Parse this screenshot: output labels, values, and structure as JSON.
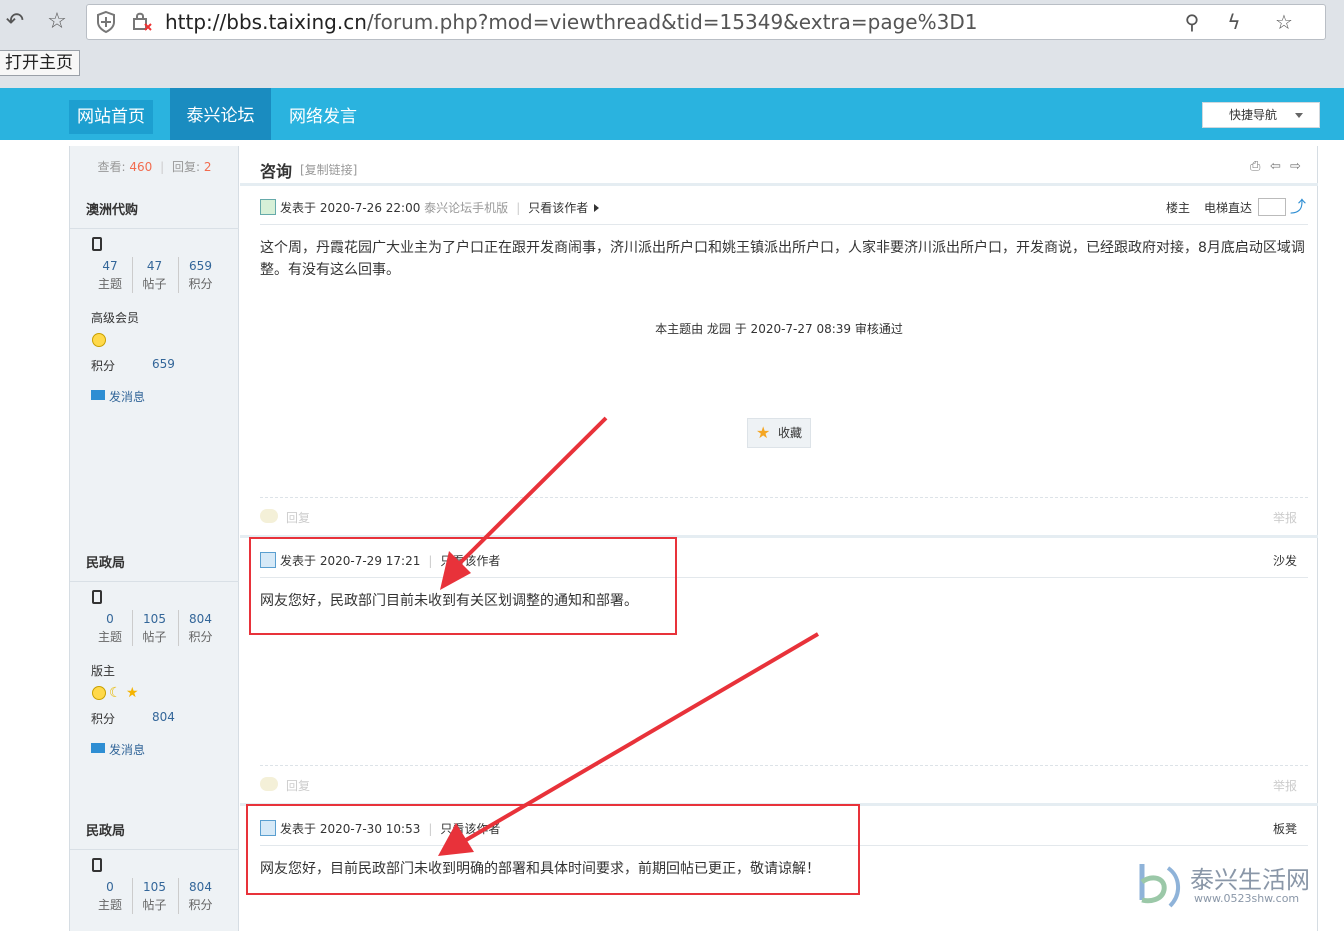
{
  "browser": {
    "url_host": "http://bbs.taixing.cn",
    "url_path": "/forum.php?mod=viewthread&tid=15349&extra=page%3D1",
    "home_button": "打开主页"
  },
  "site_nav": {
    "items": [
      "网站首页",
      "泰兴论坛",
      "网络发言"
    ],
    "quick_nav": "快捷导航"
  },
  "thread": {
    "views_label": "查看:",
    "views": "460",
    "replies_label": "回复:",
    "replies": "2",
    "title": "咨询",
    "copy_link": "[复制链接]",
    "posts": [
      {
        "author": "澳洲代购",
        "stats": [
          {
            "v": "47",
            "k": "主题"
          },
          {
            "v": "47",
            "k": "帖子"
          },
          {
            "v": "659",
            "k": "积分"
          }
        ],
        "rank": "高级会员",
        "points_label": "积分",
        "points": "659",
        "message_link": "发消息",
        "posted_prefix": "发表于",
        "posted_time": "2020-7-26 22:00",
        "source": "泰兴论坛手机版",
        "only_author": "只看该作者",
        "floor": "楼主",
        "elevator": "电梯直达",
        "body": "这个周，丹霞花园广大业主为了户口正在跟开发商闹事，济川派出所户口和姚王镇派出所户口，人家非要济川派出所户口，开发商说，已经跟政府对接，8月底启动区域调整。有没有这么回事。",
        "approved": "本主题由 龙园 于 2020-7-27 08:39 审核通过",
        "favorite": "收藏",
        "reply": "回复",
        "report": "举报"
      },
      {
        "author": "民政局",
        "stats": [
          {
            "v": "0",
            "k": "主题"
          },
          {
            "v": "105",
            "k": "帖子"
          },
          {
            "v": "804",
            "k": "积分"
          }
        ],
        "rank": "版主",
        "points_label": "积分",
        "points": "804",
        "message_link": "发消息",
        "posted_prefix": "发表于",
        "posted_time": "2020-7-29 17:21",
        "only_author": "只看该作者",
        "floor": "沙发",
        "body": "网友您好，民政部门目前未收到有关区划调整的通知和部署。",
        "reply": "回复",
        "report": "举报"
      },
      {
        "author": "民政局",
        "stats": [
          {
            "v": "0",
            "k": "主题"
          },
          {
            "v": "105",
            "k": "帖子"
          },
          {
            "v": "804",
            "k": "积分"
          }
        ],
        "posted_prefix": "发表于",
        "posted_time": "2020-7-30 10:53",
        "only_author": "只看该作者",
        "floor": "板凳",
        "body": "网友您好，目前民政部门未收到明确的部署和具体时间要求，前期回帖已更正，敬请谅解！"
      }
    ]
  },
  "watermark": {
    "name": "泰兴生活网",
    "url": "www.0523shw.com"
  },
  "colors": {
    "nav_bg": "#2ab3df",
    "annotation_red": "#e8323a"
  }
}
